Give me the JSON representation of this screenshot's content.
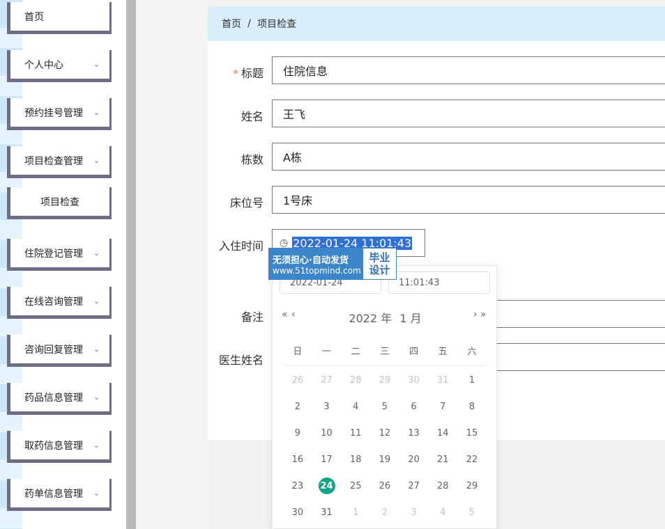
{
  "sidebar": {
    "items": [
      {
        "label": "首页",
        "has_chevron": false
      },
      {
        "label": "个人中心",
        "has_chevron": true
      },
      {
        "label": "预约挂号管理",
        "has_chevron": true
      },
      {
        "label": "项目检查管理",
        "has_chevron": true
      },
      {
        "label": "项目检查",
        "has_chevron": false,
        "sub": true
      },
      {
        "label": "住院登记管理",
        "has_chevron": true
      },
      {
        "label": "在线咨询管理",
        "has_chevron": true
      },
      {
        "label": "咨询回复管理",
        "has_chevron": true
      },
      {
        "label": "药品信息管理",
        "has_chevron": true
      },
      {
        "label": "取药信息管理",
        "has_chevron": true
      },
      {
        "label": "药单信息管理",
        "has_chevron": true
      }
    ],
    "chevron": "chevron-down-icon"
  },
  "breadcrumb": {
    "home": "首页",
    "separator": "/",
    "current": "项目检查"
  },
  "form": {
    "title_label": "标题",
    "title_required": "*",
    "title_value": "住院信息",
    "name_label": "姓名",
    "name_value": "王飞",
    "building_label": "栋数",
    "building_value": "A栋",
    "bed_label": "床位号",
    "bed_value": "1号床",
    "checkin_label": "入住时间",
    "checkin_value": "2022-01-24 11:01:43",
    "remark_label": "备注",
    "doctor_label": "医生姓名"
  },
  "watermark": {
    "line1": "无须担心·自动发货",
    "line2": "www.51topmind.com",
    "right1": "毕业",
    "right2": "设计"
  },
  "picker": {
    "date_input": "2022-01-24",
    "time_input": "11:01:43",
    "year": "2022 年",
    "month": "1 月",
    "prev_year": "«",
    "prev_month": "‹",
    "next_month": "›",
    "next_year": "»",
    "weekdays": [
      "日",
      "一",
      "二",
      "三",
      "四",
      "五",
      "六"
    ],
    "weeks": [
      [
        {
          "d": "26",
          "o": true
        },
        {
          "d": "27",
          "o": true
        },
        {
          "d": "28",
          "o": true
        },
        {
          "d": "29",
          "o": true
        },
        {
          "d": "30",
          "o": true
        },
        {
          "d": "31",
          "o": true
        },
        {
          "d": "1"
        }
      ],
      [
        {
          "d": "2"
        },
        {
          "d": "3"
        },
        {
          "d": "4"
        },
        {
          "d": "5"
        },
        {
          "d": "6"
        },
        {
          "d": "7"
        },
        {
          "d": "8"
        }
      ],
      [
        {
          "d": "9"
        },
        {
          "d": "10"
        },
        {
          "d": "11"
        },
        {
          "d": "12"
        },
        {
          "d": "13"
        },
        {
          "d": "14"
        },
        {
          "d": "15"
        }
      ],
      [
        {
          "d": "16"
        },
        {
          "d": "17"
        },
        {
          "d": "18"
        },
        {
          "d": "19"
        },
        {
          "d": "20"
        },
        {
          "d": "21"
        },
        {
          "d": "22"
        }
      ],
      [
        {
          "d": "23"
        },
        {
          "d": "24",
          "today": true
        },
        {
          "d": "25"
        },
        {
          "d": "26"
        },
        {
          "d": "27"
        },
        {
          "d": "28"
        },
        {
          "d": "29"
        }
      ],
      [
        {
          "d": "30"
        },
        {
          "d": "31"
        },
        {
          "d": "1",
          "o": true
        },
        {
          "d": "2",
          "o": true
        },
        {
          "d": "3",
          "o": true
        },
        {
          "d": "4",
          "o": true
        },
        {
          "d": "5",
          "o": true
        }
      ]
    ],
    "selected_color": "#13a589"
  }
}
